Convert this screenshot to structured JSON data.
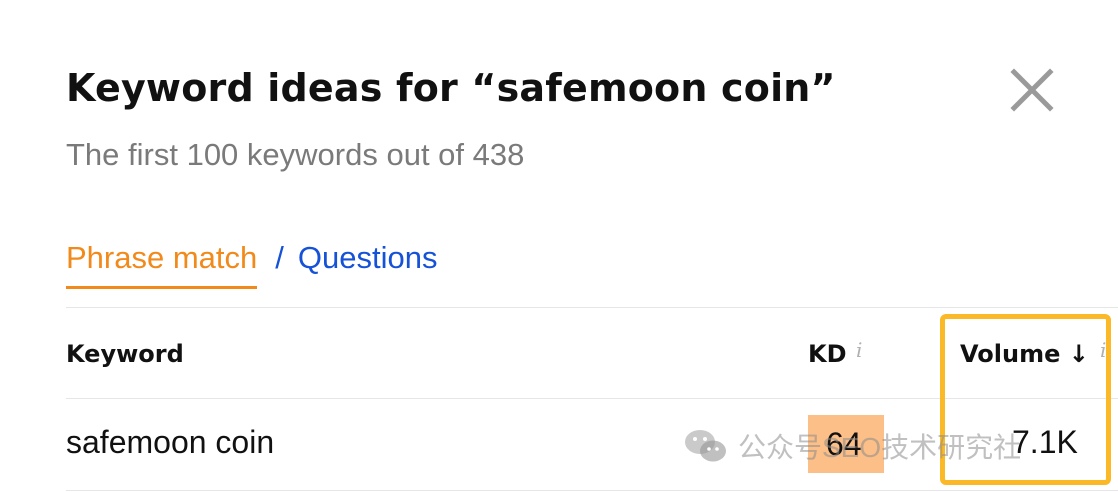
{
  "dialog": {
    "title": "Keyword ideas for “safemoon coin”",
    "subtitle": "The first 100 keywords out of 438"
  },
  "tabs": {
    "active": "Phrase match",
    "separator": "/",
    "other": "Questions"
  },
  "table": {
    "columns": {
      "keyword": "Keyword",
      "kd": "KD",
      "volume": "Volume ↓",
      "info_glyph": "i"
    },
    "rows": [
      {
        "keyword": "safemoon coin",
        "kd": "64",
        "volume": "7.1K"
      }
    ]
  },
  "watermark": {
    "text": "公众号SEO技术研究社",
    "icon": "wechat-icon"
  },
  "colors": {
    "accent_orange": "#f28a1b",
    "link_blue": "#1652d8",
    "kd_badge": "#fbbf87",
    "highlight_box": "#fbb928"
  }
}
